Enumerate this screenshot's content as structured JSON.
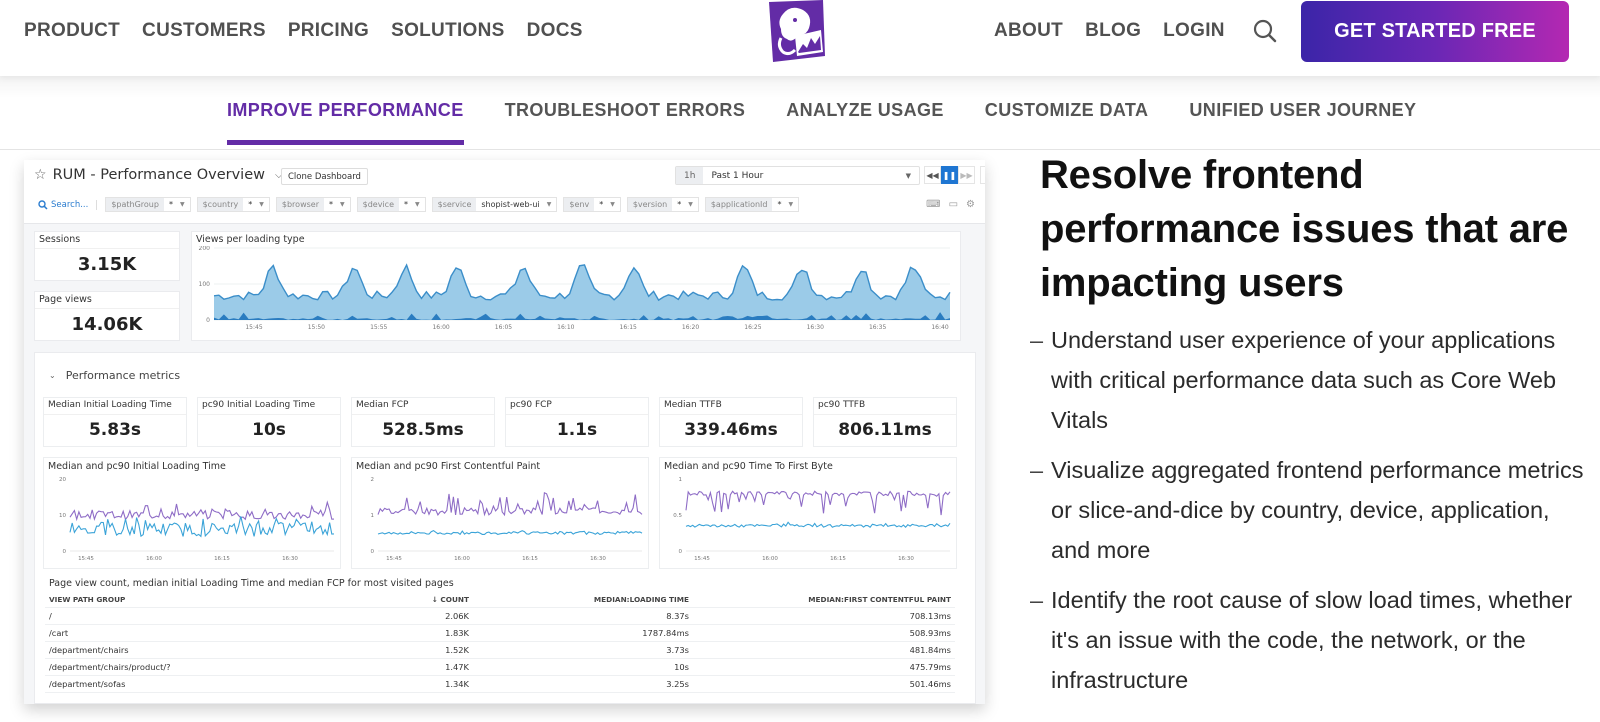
{
  "nav": {
    "left_links": [
      "PRODUCT",
      "CUSTOMERS",
      "PRICING",
      "SOLUTIONS",
      "DOCS"
    ],
    "right_links": [
      "ABOUT",
      "BLOG",
      "LOGIN"
    ],
    "logo_icon": "datadog-logo-icon",
    "search_icon": "search-icon",
    "cta_label": "GET STARTED FREE",
    "brand_color": "#632ca6"
  },
  "subnav": {
    "tabs": [
      {
        "label": "IMPROVE PERFORMANCE",
        "active": true
      },
      {
        "label": "TROUBLESHOOT ERRORS",
        "active": false
      },
      {
        "label": "ANALYZE USAGE",
        "active": false
      },
      {
        "label": "CUSTOMIZE DATA",
        "active": false
      },
      {
        "label": "UNIFIED USER JOURNEY",
        "active": false
      }
    ]
  },
  "dashboard": {
    "title": "RUM - Performance Overview",
    "clone_label": "Clone Dashboard",
    "time_pill": "1h",
    "time_range": "Past 1 Hour",
    "search_placeholder": "Search...",
    "filters": [
      {
        "key": "$pathGroup",
        "value": "*"
      },
      {
        "key": "$country",
        "value": "*"
      },
      {
        "key": "$browser",
        "value": "*"
      },
      {
        "key": "$device",
        "value": "*"
      },
      {
        "key": "$service",
        "value": "shopist-web-ui"
      },
      {
        "key": "$env",
        "value": "*"
      },
      {
        "key": "$version",
        "value": "*"
      },
      {
        "key": "$applicationId",
        "value": "*"
      }
    ],
    "sessions": {
      "label": "Sessions",
      "value": "3.15K"
    },
    "page_views": {
      "label": "Page views",
      "value": "14.06K"
    },
    "views_chart": {
      "title": "Views per loading type",
      "y_ticks": [
        "200",
        "100",
        "0"
      ],
      "x_ticks": [
        "15:45",
        "15:50",
        "15:55",
        "16:00",
        "16:05",
        "16:10",
        "16:15",
        "16:20",
        "16:25",
        "16:30",
        "16:35",
        "16:40"
      ]
    },
    "section_title": "Performance metrics",
    "metrics": [
      {
        "label": "Median Initial Loading Time",
        "value": "5.83s"
      },
      {
        "label": "pc90 Initial Loading Time",
        "value": "10s"
      },
      {
        "label": "Median FCP",
        "value": "528.5ms"
      },
      {
        "label": "pc90 FCP",
        "value": "1.1s"
      },
      {
        "label": "Median TTFB",
        "value": "339.46ms"
      },
      {
        "label": "pc90 TTFB",
        "value": "806.11ms"
      }
    ],
    "timeseries": [
      {
        "title": "Median and pc90 Initial Loading Time",
        "y_ticks": [
          "20",
          "10",
          "0"
        ],
        "x_ticks": [
          "15:45",
          "16:00",
          "16:15",
          "16:30"
        ]
      },
      {
        "title": "Median and pc90 First Contentful Paint",
        "y_ticks": [
          "2",
          "1",
          "0"
        ],
        "x_ticks": [
          "15:45",
          "16:00",
          "16:15",
          "16:30"
        ]
      },
      {
        "title": "Median and pc90 Time To First Byte",
        "y_ticks": [
          "1",
          "0.5",
          "0"
        ],
        "x_ticks": [
          "15:45",
          "16:00",
          "16:15",
          "16:30"
        ]
      }
    ],
    "series_colors": {
      "pc90": "#8e6cc6",
      "median": "#3aa3d8",
      "area": "#9bcbe8",
      "area_line": "#3b8ec9",
      "area_dark": "#2a7cc0"
    },
    "table": {
      "title": "Page view count, median initial Loading Time and median FCP for most visited pages",
      "headers": [
        "VIEW PATH GROUP",
        "↓ COUNT",
        "MEDIAN:LOADING TIME",
        "MEDIAN:FIRST CONTENTFUL PAINT"
      ],
      "rows": [
        [
          "/",
          "2.06K",
          "8.37s",
          "708.13ms"
        ],
        [
          "/cart",
          "1.83K",
          "1787.84ms",
          "508.93ms"
        ],
        [
          "/department/chairs",
          "1.52K",
          "3.73s",
          "481.84ms"
        ],
        [
          "/department/chairs/product/?",
          "1.47K",
          "10s",
          "475.79ms"
        ],
        [
          "/department/sofas",
          "1.34K",
          "3.25s",
          "501.46ms"
        ]
      ]
    }
  },
  "copy": {
    "headline": "Resolve frontend performance issues that are impacting users",
    "bullets": [
      "Understand user experience of your applications with critical performance data such as Core Web Vitals",
      "Visualize aggregated frontend performance metrics or slice-and-dice by country, device, application, and more",
      "Identify the root cause of slow load times, whether it's an issue with the code, the network, or the infrastructure"
    ]
  }
}
